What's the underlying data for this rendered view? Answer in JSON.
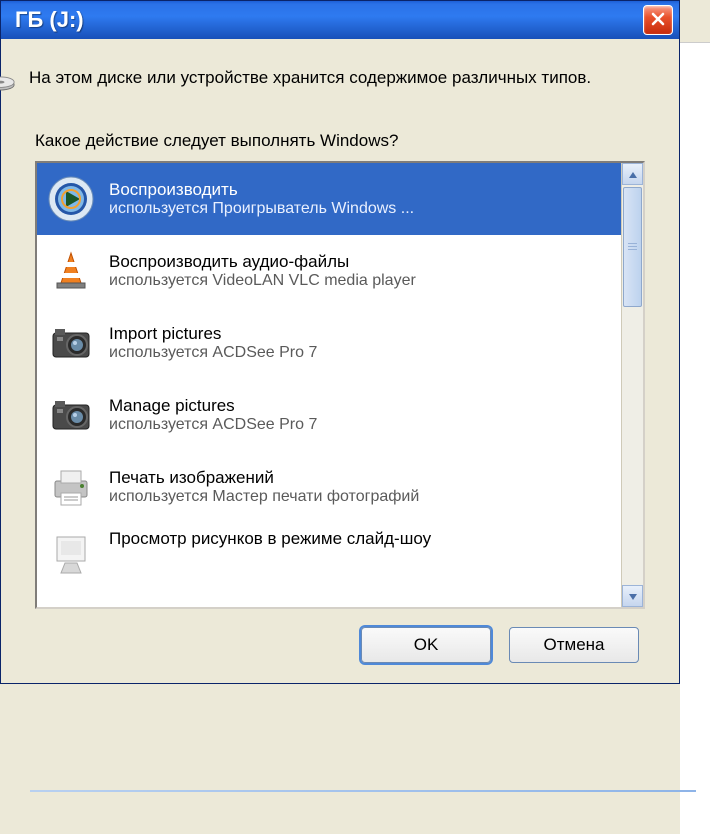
{
  "titlebar": {
    "title": "ГБ (J:)"
  },
  "intro": "На этом диске или устройстве хранится содержимое различных типов.",
  "prompt": "Какое действие следует выполнять Windows?",
  "actions": [
    {
      "title": "Воспроизводить",
      "sub": "используется Проигрыватель Windows ...",
      "icon": "wmp",
      "selected": true
    },
    {
      "title": "Воспроизводить аудио-файлы",
      "sub": "используется VideoLAN VLC media player",
      "icon": "vlc"
    },
    {
      "title": "Import pictures",
      "sub": "используется ACDSee Pro 7",
      "icon": "camera"
    },
    {
      "title": "Manage pictures",
      "sub": "используется ACDSee Pro 7",
      "icon": "camera"
    },
    {
      "title": "Печать изображений",
      "sub": "используется Мастер печати фотографий",
      "icon": "printer"
    },
    {
      "title": "Просмотр рисунков в режиме слайд-шоу",
      "sub": "",
      "icon": "screen",
      "partial": true
    }
  ],
  "buttons": {
    "ok": "OK",
    "cancel": "Отмена"
  }
}
